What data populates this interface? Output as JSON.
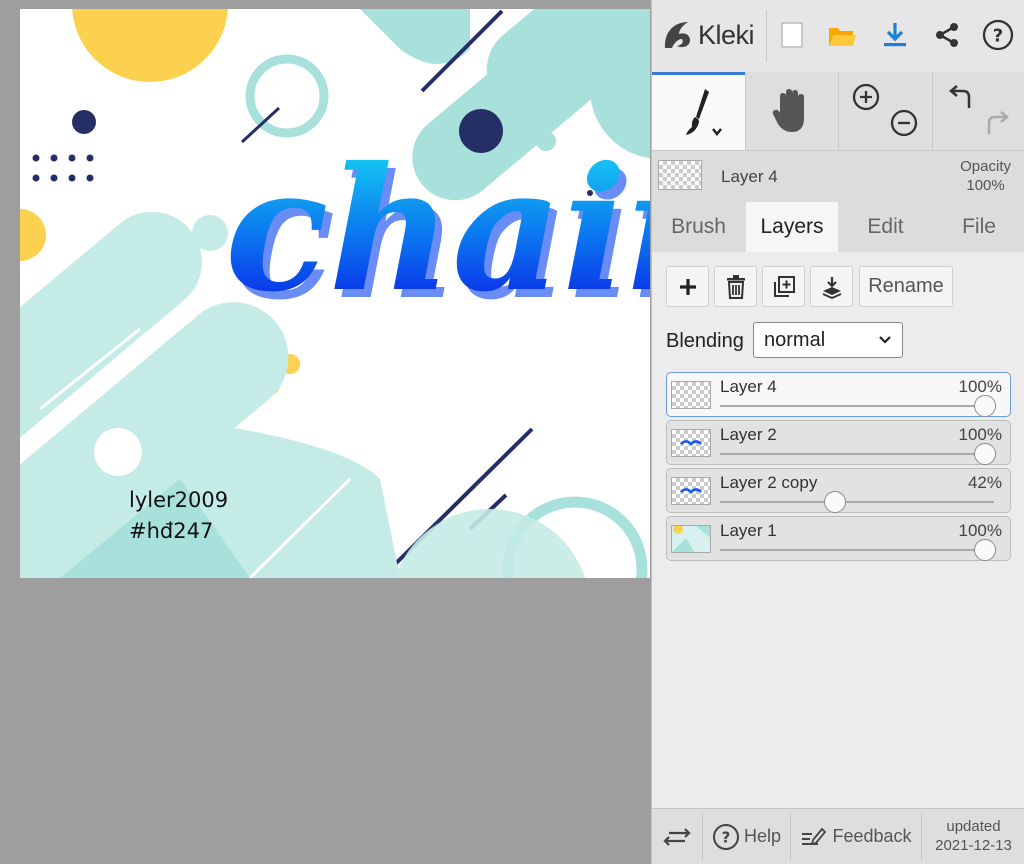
{
  "artwork": {
    "lettering": "chaii",
    "watermark_line1": "lyler2009",
    "watermark_line2": "#hđ247"
  },
  "app": {
    "name": "Kleki",
    "accent_color": "#3a7bd5"
  },
  "toolbar": {
    "icons": [
      "new-file-icon",
      "open-folder-icon",
      "download-icon",
      "share-icon",
      "help-icon"
    ]
  },
  "tools": [
    "brush-tool",
    "hand-tool",
    "zoom-tool",
    "undo-redo-tool"
  ],
  "current_layer": {
    "name": "Layer 4",
    "opacity_label": "Opacity",
    "opacity_value": "100%"
  },
  "tabs": [
    {
      "label": "Brush",
      "active": false
    },
    {
      "label": "Layers",
      "active": true
    },
    {
      "label": "Edit",
      "active": false
    },
    {
      "label": "File",
      "active": false
    }
  ],
  "layer_actions": {
    "rename_label": "Rename"
  },
  "blending": {
    "label": "Blending",
    "value": "normal"
  },
  "layers": [
    {
      "name": "Layer 4",
      "opacity_label": "100%",
      "opacity": 1.0,
      "selected": true
    },
    {
      "name": "Layer 2",
      "opacity_label": "100%",
      "opacity": 1.0,
      "selected": false
    },
    {
      "name": "Layer 2 copy",
      "opacity_label": "42%",
      "opacity": 0.42,
      "selected": false
    },
    {
      "name": "Layer 1",
      "opacity_label": "100%",
      "opacity": 1.0,
      "selected": false
    }
  ],
  "footer": {
    "help_label": "Help",
    "feedback_label": "Feedback",
    "updated_label": "updated",
    "updated_date": "2021-12-13"
  }
}
